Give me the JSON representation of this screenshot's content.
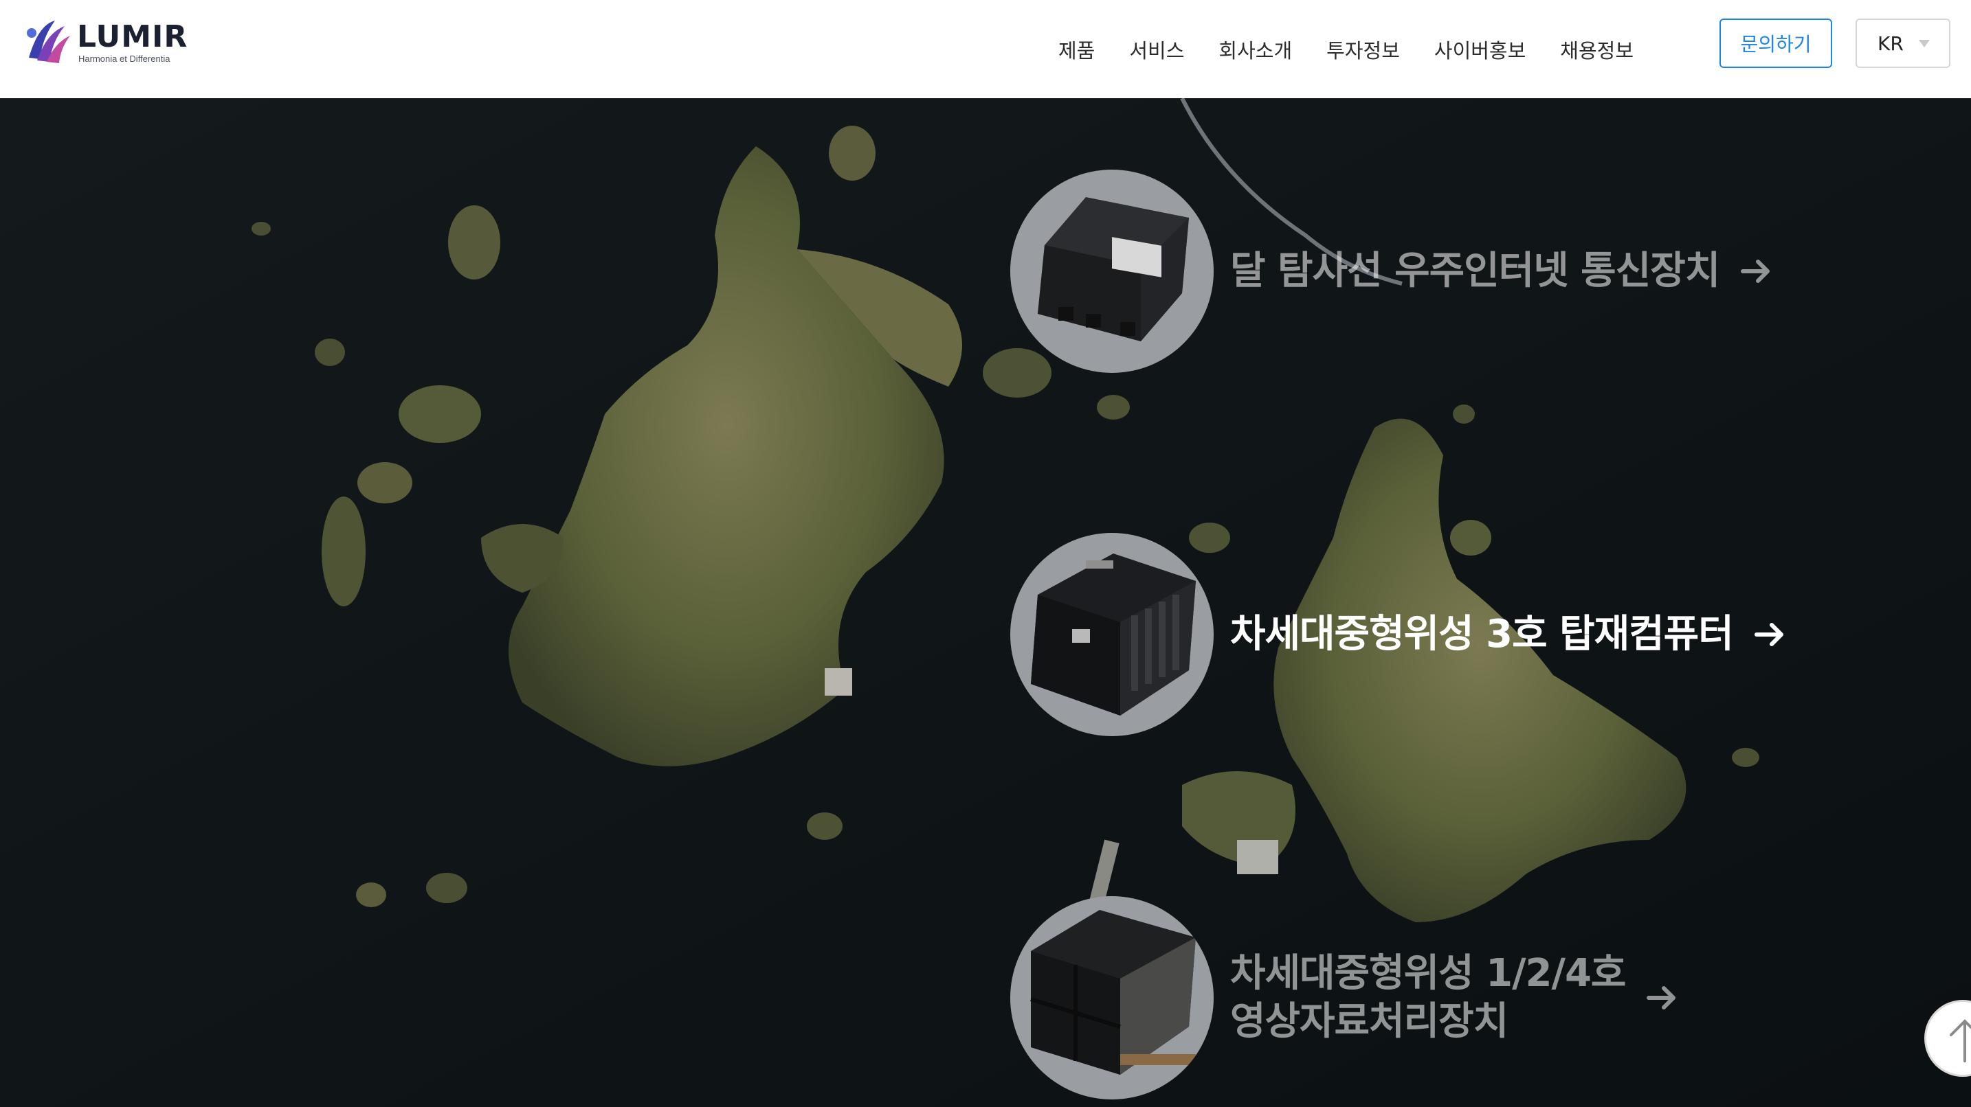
{
  "header": {
    "logo_text": "LUMIR",
    "logo_tagline": "Harmonia et Differentia",
    "nav": [
      "제품",
      "서비스",
      "회사소개",
      "투자정보",
      "사이버홍보",
      "채용정보"
    ],
    "contact_label": "문의하기",
    "language": "KR"
  },
  "products": [
    {
      "title_lines": [
        "달 탐사선 우주인터넷 통신장치"
      ],
      "active": false,
      "icon": "comm-device-icon"
    },
    {
      "title_lines": [
        "차세대중형위성 3호 탑재컴퓨터"
      ],
      "active": true,
      "icon": "onboard-computer-icon"
    },
    {
      "title_lines": [
        "차세대중형위성 1/2/4호",
        "영상자료처리장치"
      ],
      "active": false,
      "icon": "image-processor-icon"
    }
  ],
  "colors": {
    "accent": "#1c86e8",
    "header_bg": "#ffffff",
    "thumb_bg": "#9a9da2",
    "sea": "#0e1315",
    "land": "#5f6440"
  }
}
